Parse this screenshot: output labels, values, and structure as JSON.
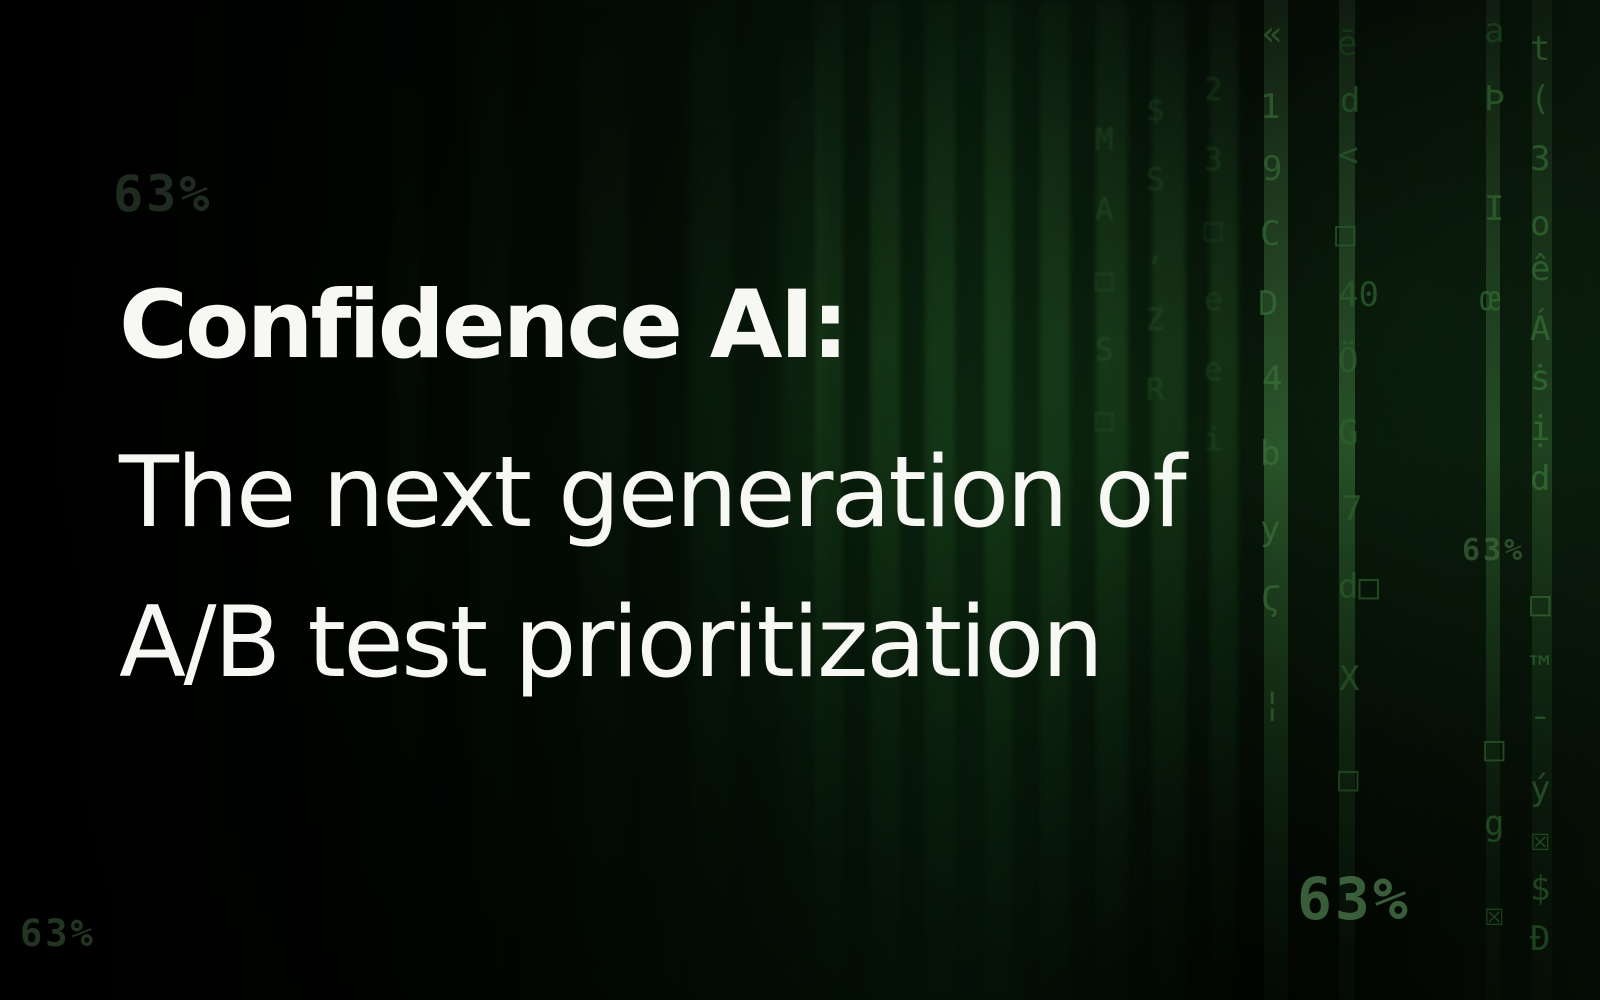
{
  "hero": {
    "title": "Confidence AI:",
    "subtitle": "The next generation of\nA/B test prioritization"
  },
  "background": {
    "percent_labels": [
      "63%",
      "63%",
      "63%",
      "63%"
    ],
    "theme": {
      "primary_green": "#4ea94f",
      "bright_green": "#6bd06a",
      "dark_background": "#020402",
      "text_color": "#f7f7f4"
    }
  }
}
